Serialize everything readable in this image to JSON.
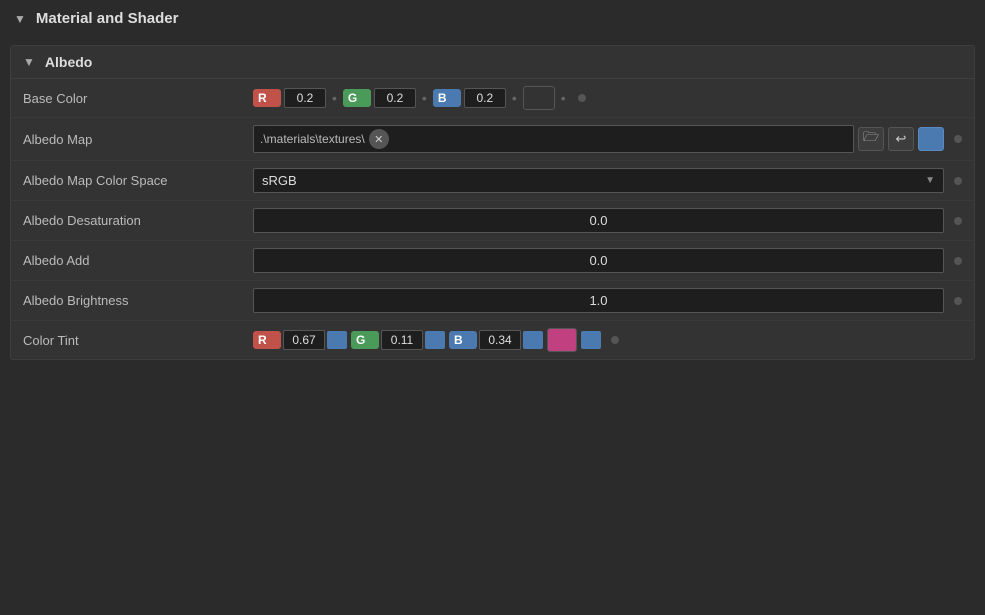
{
  "panel": {
    "title": "Material and Shader",
    "title_arrow": "▼"
  },
  "albedo": {
    "section_label": "Albedo",
    "section_arrow": "▼",
    "rows": [
      {
        "id": "base-color",
        "label": "Base Color",
        "type": "color-rgb",
        "r": "0.2",
        "g": "0.2",
        "b": "0.2",
        "preview_color": "#333333"
      },
      {
        "id": "albedo-map",
        "label": "Albedo Map",
        "type": "texture",
        "path": ".\\materials\\textures\\"
      },
      {
        "id": "albedo-map-color-space",
        "label": "Albedo Map Color Space",
        "type": "dropdown",
        "value": "sRGB"
      },
      {
        "id": "albedo-desaturation",
        "label": "Albedo Desaturation",
        "type": "number",
        "value": "0.0"
      },
      {
        "id": "albedo-add",
        "label": "Albedo Add",
        "type": "number",
        "value": "0.0"
      },
      {
        "id": "albedo-brightness",
        "label": "Albedo Brightness",
        "type": "number",
        "value": "1.0"
      },
      {
        "id": "color-tint",
        "label": "Color Tint",
        "type": "color-rgb-tint",
        "r": "0.67",
        "g": "0.11",
        "b": "0.34",
        "tint_color": "#c04080"
      }
    ]
  },
  "labels": {
    "r": "R",
    "g": "G",
    "b": "B",
    "clear_icon": "✕",
    "folder_icon": "📁",
    "share_icon": "↩",
    "dropdown_arrow": "▼"
  }
}
